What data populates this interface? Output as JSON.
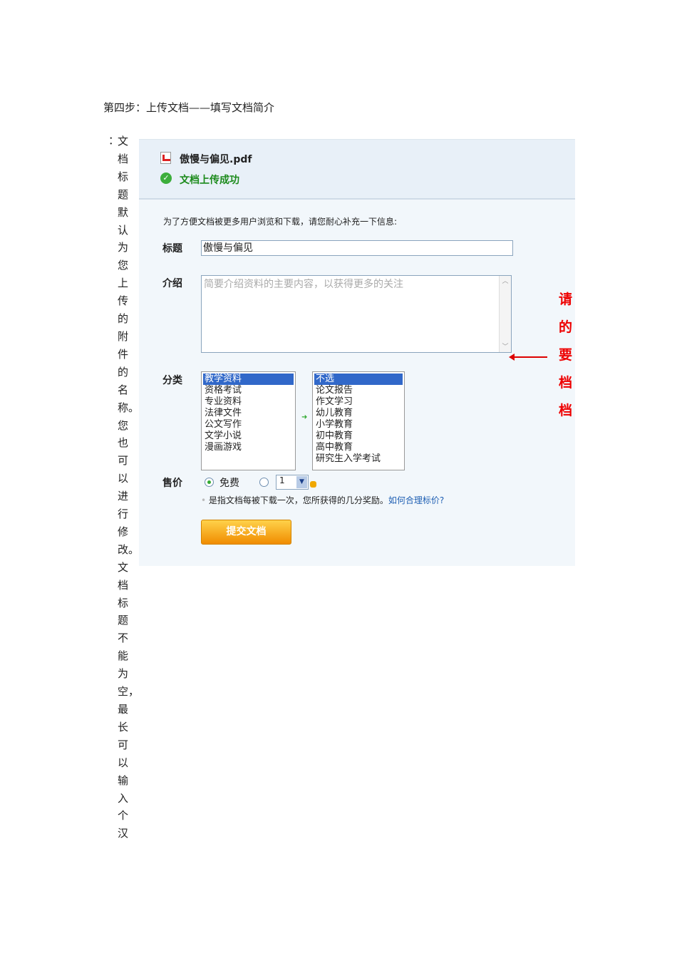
{
  "step_title": "第四步：上传文档——填写文档简介",
  "side_colon": "：",
  "side_text": "文档标题默认为您上传的附件的名称。您也可以进行修改。文档标题不能为空，最长可以输入　个汉",
  "screenshot": {
    "file_name": "傲慢与偏见.pdf",
    "upload_status": "文档上传成功",
    "intro": "为了方便文档被更多用户浏览和下载，请您耐心补充一下信息:",
    "title_label": "标题",
    "title_value": "傲慢与偏见",
    "desc_label": "介绍",
    "desc_placeholder": "简要介绍资料的主要内容，以获得更多的关注",
    "category_label": "分类",
    "category_list1": [
      "教学资料",
      "资格考试",
      "专业资料",
      "法律文件",
      "公文写作",
      "文学小说",
      "漫画游戏"
    ],
    "category_list2": [
      "不选",
      "论文报告",
      "作文学习",
      "幼儿教育",
      "小学教育",
      "初中教育",
      "高中教育",
      "研究生入学考试"
    ],
    "price_label": "售价",
    "price_free": "免费",
    "price_value": "1",
    "price_note": "是指文档每被下载一次，您所获得的几分奖励。",
    "price_link": "如何合理标价?",
    "submit": "提交文档",
    "annotation_chars": [
      "请",
      "的",
      "要",
      "档",
      "档"
    ]
  }
}
